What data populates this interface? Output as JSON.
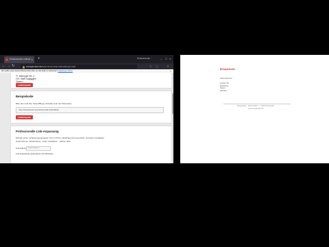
{
  "browser": {
    "tab": {
      "title": "Professionelle Linkbuil…"
    },
    "right_tab_label": "Professionelle…",
    "new_tab": "+",
    "url": {
      "host": "example-links.de",
      "path": "/de/professionelle-linkbuilding/kontakt"
    },
    "notification": {
      "text": "Wir wollen einen kurzen Moment Ihrer Zeit, um die Seite zu verbessern",
      "link": "Fragebogen öffnen"
    },
    "icons": {
      "back": "back-arrow-icon",
      "forward": "forward-arrow-icon",
      "reload": "reload-icon",
      "menu": "menu-icon"
    }
  },
  "page": {
    "address": {
      "line1": "Tr. Mikeoglu Str. 2",
      "line2": "Ort: Staff Kagaggen",
      "line3": "Zypern"
    },
    "card1_button": "Linkbeispiele",
    "card2": {
      "title": "Beispielseite",
      "para": "Bitte hier sind Ihre Seiten/Blogs. Aktuelle Liste der Webseiten.",
      "input_value": "https://beispielseite.de/professionelle-linkbuilding/",
      "button": "Linkbeispiele"
    },
    "card3": {
      "title": "Professionelle Link-Anpassung",
      "para1": "Einfach einen verlinkungsrelevanten Text in Ihrem Inhaltsbereich aussuchen und dann bestätigen.",
      "para2": "Unternehmen: Medienbank · Autor: Redaktion · Status: aktiv",
      "label1": "Link-Adresse:",
      "mini_placeholder": "Eingabe Adresse",
      "label2": "Link-Anpassung (optional) für Ihre Webseite"
    }
  },
  "doc": {
    "brand": "Beispielseite",
    "labels": [
      "Liefer-Referenz",
      "",
      "Kunden-Nr.",
      "Bestellung",
      "Datum",
      "Zeitraum"
    ],
    "footer1": "Beispielseite · Musterstraße 1 · 12345 Musterstadt",
    "footer2": "www.beispielseite.de"
  }
}
